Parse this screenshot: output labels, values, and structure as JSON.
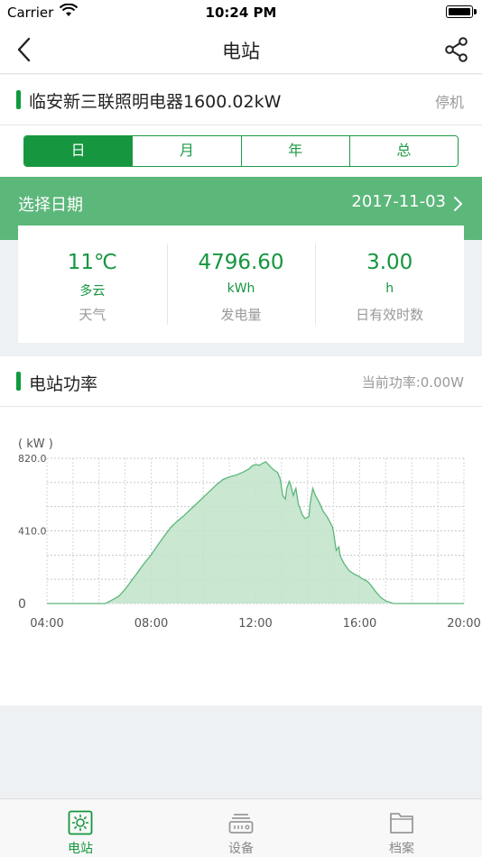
{
  "status_bar": {
    "carrier": "Carrier",
    "time": "10:24 PM"
  },
  "nav": {
    "title": "电站",
    "back_icon": "chevron-left-icon",
    "share_icon": "share-icon"
  },
  "station": {
    "name": "临安新三联照明电器1600.02kW",
    "status": "停机"
  },
  "period_tabs": [
    {
      "label": "日",
      "active": true
    },
    {
      "label": "月",
      "active": false
    },
    {
      "label": "年",
      "active": false
    },
    {
      "label": "总",
      "active": false
    }
  ],
  "date_select": {
    "label": "选择日期",
    "date": "2017-11-03"
  },
  "stats": [
    {
      "value": "11℃",
      "unit": "多云",
      "caption": "天气"
    },
    {
      "value": "4796.60",
      "unit": "kWh",
      "caption": "发电量"
    },
    {
      "value": "3.00",
      "unit": "h",
      "caption": "日有效时数"
    }
  ],
  "power": {
    "title": "电站功率",
    "current": "当前功率:0.00W"
  },
  "colors": {
    "accent": "#15963f",
    "band": "#5cb77a",
    "area_fill": "#bfe3c9",
    "area_stroke": "#5cb77a"
  },
  "chart_data": {
    "type": "area",
    "ylabel": "( kW )",
    "ylim": [
      0,
      820
    ],
    "yticks": [
      {
        "value": 820,
        "label": "820.0"
      },
      {
        "value": 410,
        "label": "410.0"
      },
      {
        "value": 0,
        "label": "0"
      }
    ],
    "xlim": [
      4,
      20
    ],
    "xticks": [
      {
        "value": 4,
        "label": "04:00"
      },
      {
        "value": 8,
        "label": "08:00"
      },
      {
        "value": 12,
        "label": "12:00"
      },
      {
        "value": 16,
        "label": "16:00"
      },
      {
        "value": 20,
        "label": "20:00"
      }
    ],
    "grid": true,
    "series": [
      {
        "points": [
          [
            4,
            0
          ],
          [
            6.25,
            0
          ],
          [
            6.5,
            20
          ],
          [
            6.75,
            40
          ],
          [
            7,
            80
          ],
          [
            7.25,
            130
          ],
          [
            7.5,
            180
          ],
          [
            7.75,
            230
          ],
          [
            8,
            275
          ],
          [
            8.25,
            330
          ],
          [
            8.5,
            380
          ],
          [
            8.75,
            430
          ],
          [
            9,
            465
          ],
          [
            9.25,
            495
          ],
          [
            9.5,
            530
          ],
          [
            9.75,
            565
          ],
          [
            10,
            600
          ],
          [
            10.25,
            635
          ],
          [
            10.5,
            670
          ],
          [
            10.75,
            700
          ],
          [
            11,
            715
          ],
          [
            11.25,
            725
          ],
          [
            11.5,
            740
          ],
          [
            11.75,
            760
          ],
          [
            11.9,
            780
          ],
          [
            12.05,
            785
          ],
          [
            12.15,
            780
          ],
          [
            12.25,
            790
          ],
          [
            12.4,
            800
          ],
          [
            12.55,
            775
          ],
          [
            12.7,
            755
          ],
          [
            12.85,
            740
          ],
          [
            12.95,
            705
          ],
          [
            13.05,
            610
          ],
          [
            13.15,
            590
          ],
          [
            13.2,
            650
          ],
          [
            13.3,
            690
          ],
          [
            13.35,
            670
          ],
          [
            13.45,
            610
          ],
          [
            13.55,
            650
          ],
          [
            13.65,
            560
          ],
          [
            13.8,
            500
          ],
          [
            13.9,
            480
          ],
          [
            14.05,
            490
          ],
          [
            14.1,
            565
          ],
          [
            14.2,
            650
          ],
          [
            14.3,
            610
          ],
          [
            14.45,
            570
          ],
          [
            14.6,
            520
          ],
          [
            14.75,
            490
          ],
          [
            14.95,
            435
          ],
          [
            15,
            400
          ],
          [
            15.1,
            300
          ],
          [
            15.2,
            320
          ],
          [
            15.25,
            270
          ],
          [
            15.4,
            225
          ],
          [
            15.6,
            185
          ],
          [
            15.8,
            165
          ],
          [
            15.95,
            155
          ],
          [
            16.1,
            140
          ],
          [
            16.3,
            125
          ],
          [
            16.45,
            100
          ],
          [
            16.6,
            70
          ],
          [
            16.8,
            35
          ],
          [
            17,
            15
          ],
          [
            17.3,
            0
          ],
          [
            20,
            0
          ]
        ]
      }
    ]
  },
  "tabbar": [
    {
      "label": "电站",
      "icon": "sun-icon",
      "active": true
    },
    {
      "label": "设备",
      "icon": "inverter-icon",
      "active": false
    },
    {
      "label": "档案",
      "icon": "folder-icon",
      "active": false
    }
  ]
}
